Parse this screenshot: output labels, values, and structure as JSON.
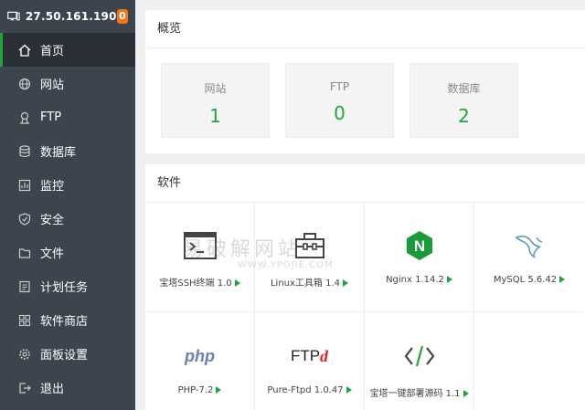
{
  "sidebar": {
    "ip": "27.50.161.190",
    "badge": "0",
    "items": [
      {
        "label": "首页",
        "icon": "home-icon"
      },
      {
        "label": "网站",
        "icon": "globe-icon"
      },
      {
        "label": "FTP",
        "icon": "ftp-icon"
      },
      {
        "label": "数据库",
        "icon": "database-icon"
      },
      {
        "label": "监控",
        "icon": "monitor-icon"
      },
      {
        "label": "安全",
        "icon": "shield-icon"
      },
      {
        "label": "文件",
        "icon": "folder-icon"
      },
      {
        "label": "计划任务",
        "icon": "task-icon"
      },
      {
        "label": "软件商店",
        "icon": "apps-icon"
      },
      {
        "label": "面板设置",
        "icon": "gear-icon"
      },
      {
        "label": "退出",
        "icon": "logout-icon"
      }
    ]
  },
  "overview": {
    "title": "概览",
    "cards": [
      {
        "label": "网站",
        "value": "1"
      },
      {
        "label": "FTP",
        "value": "0"
      },
      {
        "label": "数据库",
        "value": "2"
      }
    ]
  },
  "software": {
    "title": "软件",
    "items": [
      {
        "name": "宝塔SSH终端 1.0",
        "icon": "terminal-icon"
      },
      {
        "name": "Linux工具箱 1.4",
        "icon": "toolbox-icon"
      },
      {
        "name": "Nginx 1.14.2",
        "icon": "nginx-icon"
      },
      {
        "name": "MySQL 5.6.42",
        "icon": "mysql-icon"
      },
      {
        "name": "PHP-7.2",
        "icon": "php-icon"
      },
      {
        "name": "Pure-Ftpd 1.0.47",
        "icon": "ftpd-icon"
      },
      {
        "name": "宝塔一键部署源码 1.1",
        "icon": "code-icon"
      }
    ],
    "php_logo_text": "php",
    "ftpd_logo_text": "FTP",
    "ftpd_logo_d": "d",
    "nginx_logo_text": "N"
  },
  "watermark": {
    "main": "易破解网站",
    "sub": "WWW.YPOJIE.COM"
  },
  "colors": {
    "sidebar_bg": "#3c444d",
    "accent_green": "#20a53a",
    "badge_orange": "#f0761c"
  }
}
